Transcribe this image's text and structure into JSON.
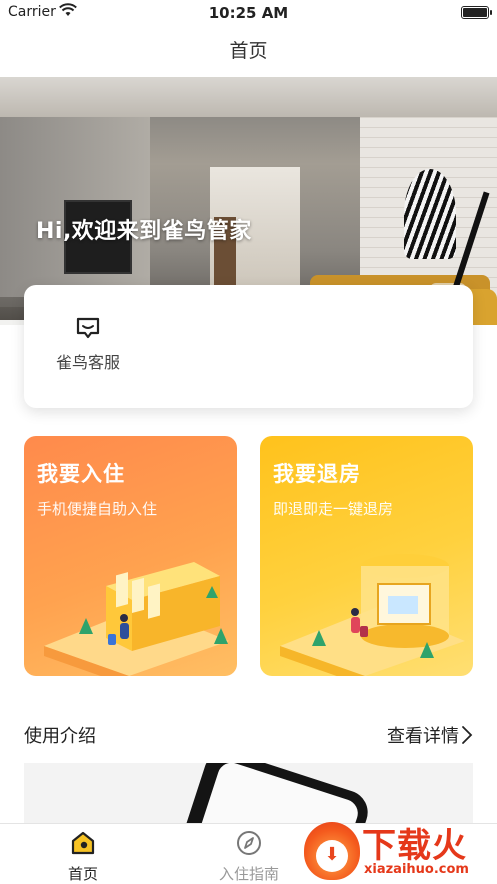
{
  "status_bar": {
    "carrier": "Carrier",
    "time": "10:25 AM"
  },
  "navbar": {
    "title": "首页"
  },
  "hero": {
    "greeting": "Hi,欢迎来到雀鸟管家"
  },
  "services": [
    {
      "label": "雀鸟客服",
      "icon": "chat-icon"
    }
  ],
  "actions": {
    "checkin": {
      "title": "我要入住",
      "subtitle": "手机便捷自助入住"
    },
    "checkout": {
      "title": "我要退房",
      "subtitle": "即退即走一键退房"
    }
  },
  "intro": {
    "title": "使用介绍",
    "link": "查看详情"
  },
  "tabbar": {
    "home": {
      "label": "首页",
      "icon": "home-icon"
    },
    "guide": {
      "label": "入住指南",
      "icon": "compass-icon"
    }
  },
  "watermark": {
    "text": "下载火",
    "url": "xiazaihuo.com"
  },
  "colors": {
    "checkin_start": "#ff8a4c",
    "checkout_start": "#ffc21c",
    "tab_active_accent": "#f7c325"
  }
}
